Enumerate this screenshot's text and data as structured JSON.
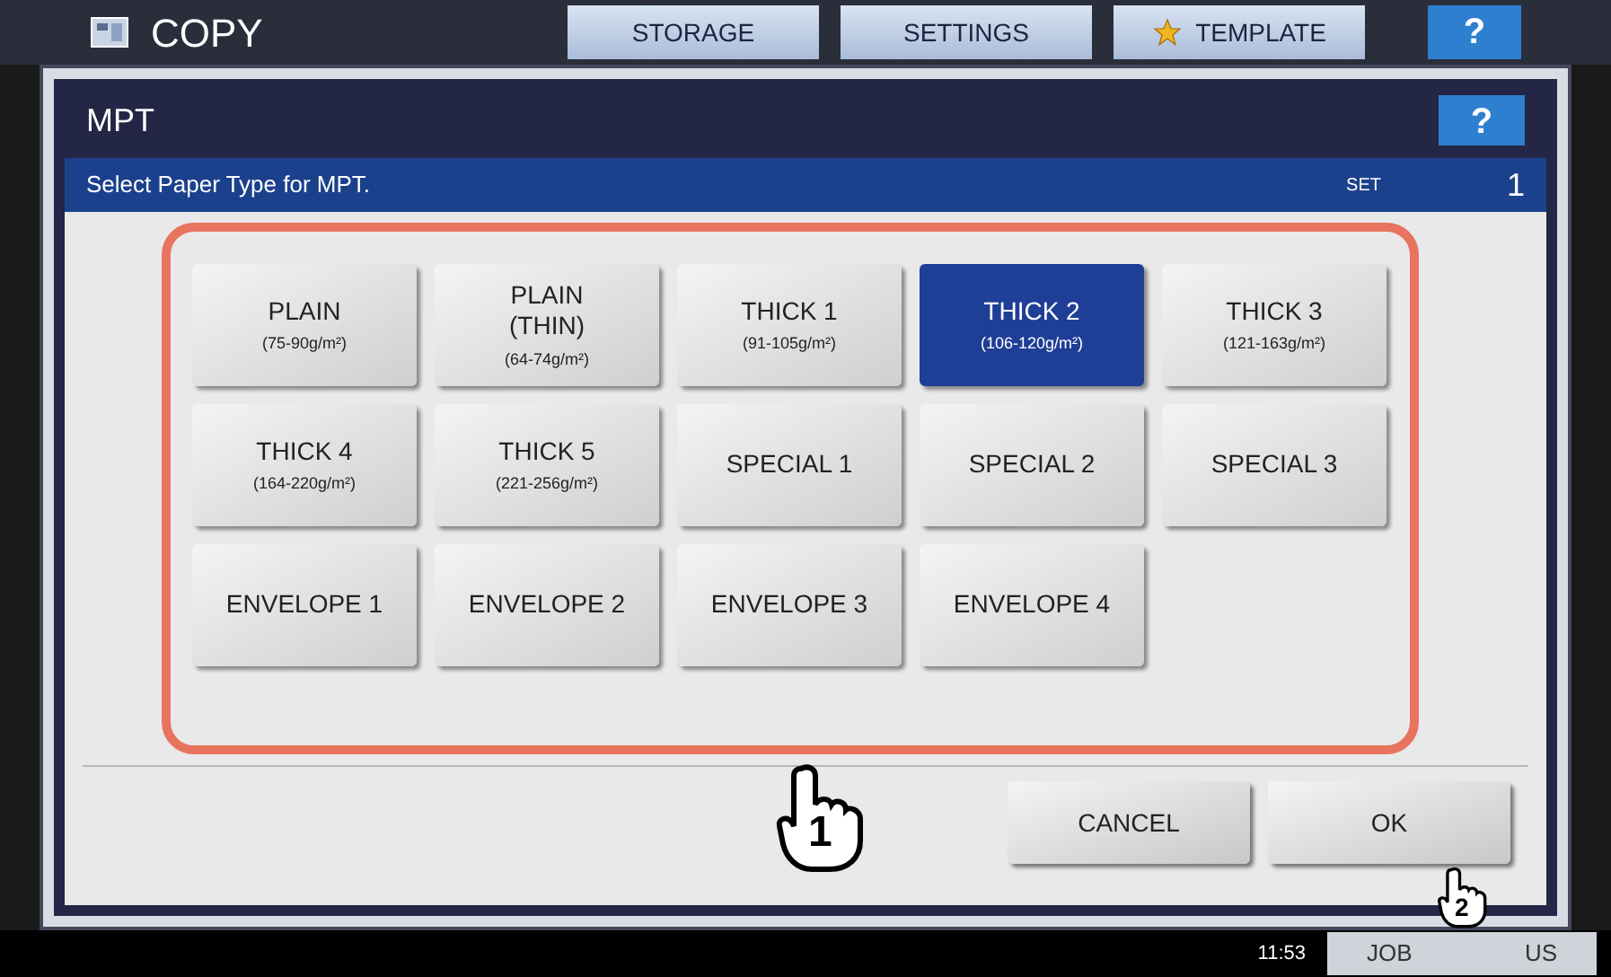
{
  "top_bar": {
    "title": "COPY",
    "tabs": [
      {
        "label": "STORAGE",
        "icon": false
      },
      {
        "label": "SETTINGS",
        "icon": false
      },
      {
        "label": "TEMPLATE",
        "icon": true
      }
    ],
    "help": "?"
  },
  "dialog": {
    "title": "MPT",
    "help": "?",
    "prompt": "Select Paper Type for MPT.",
    "set_label": "SET",
    "set_value": "1",
    "paper_types": [
      {
        "label": "PLAIN",
        "weight": "(75-90g/m²)",
        "selected": false
      },
      {
        "label": "PLAIN\n(THIN)",
        "weight": "(64-74g/m²)",
        "selected": false
      },
      {
        "label": "THICK 1",
        "weight": "(91-105g/m²)",
        "selected": false
      },
      {
        "label": "THICK 2",
        "weight": "(106-120g/m²)",
        "selected": true
      },
      {
        "label": "THICK 3",
        "weight": "(121-163g/m²)",
        "selected": false
      },
      {
        "label": "THICK 4",
        "weight": "(164-220g/m²)",
        "selected": false
      },
      {
        "label": "THICK 5",
        "weight": "(221-256g/m²)",
        "selected": false
      },
      {
        "label": "SPECIAL 1",
        "selected": false
      },
      {
        "label": "SPECIAL 2",
        "selected": false
      },
      {
        "label": "SPECIAL 3",
        "selected": false
      },
      {
        "label": "ENVELOPE 1",
        "selected": false
      },
      {
        "label": "ENVELOPE 2",
        "selected": false
      },
      {
        "label": "ENVELOPE 3",
        "selected": false
      },
      {
        "label": "ENVELOPE 4",
        "selected": false
      }
    ],
    "buttons": [
      "CANCEL",
      "OK"
    ]
  },
  "status_bar": {
    "time": "11:53",
    "job_button": [
      "JOB",
      "US"
    ]
  },
  "callouts": [
    "1",
    "2"
  ]
}
